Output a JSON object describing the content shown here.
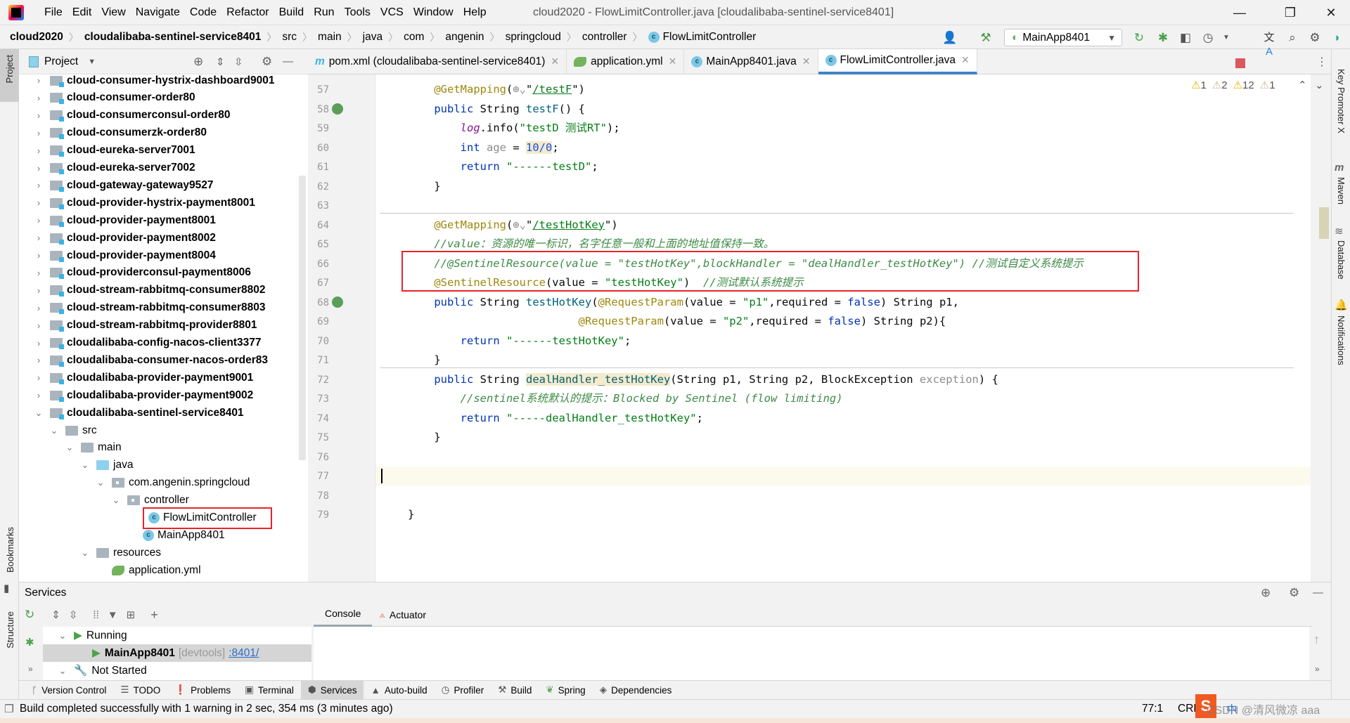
{
  "window": {
    "title": "cloud2020 - FlowLimitController.java [cloudalibaba-sentinel-service8401]"
  },
  "menu": [
    "File",
    "Edit",
    "View",
    "Navigate",
    "Code",
    "Refactor",
    "Build",
    "Run",
    "Tools",
    "VCS",
    "Window",
    "Help"
  ],
  "breadcrumb": [
    "cloud2020",
    "cloudalibaba-sentinel-service8401",
    "src",
    "main",
    "java",
    "com",
    "angenin",
    "springcloud",
    "controller",
    "FlowLimitController"
  ],
  "toolbar": {
    "run_config": "MainApp8401",
    "icons": [
      "user-icon",
      "hammer-icon",
      "rerun-icon",
      "debug-icon",
      "coverage-icon",
      "profile-icon",
      "stop-icon",
      "translate-icon",
      "search-icon",
      "settings-icon",
      "toolbox-icon"
    ]
  },
  "project": {
    "title": "Project",
    "items": [
      {
        "label": "cloud-consumer-hystrix-dashboard9001",
        "depth": 1,
        "type": "module",
        "exp": false
      },
      {
        "label": "cloud-consumer-order80",
        "depth": 1,
        "type": "module",
        "exp": false
      },
      {
        "label": "cloud-consumerconsul-order80",
        "depth": 1,
        "type": "module",
        "exp": false
      },
      {
        "label": "cloud-consumerzk-order80",
        "depth": 1,
        "type": "module",
        "exp": false
      },
      {
        "label": "cloud-eureka-server7001",
        "depth": 1,
        "type": "module",
        "exp": false
      },
      {
        "label": "cloud-eureka-server7002",
        "depth": 1,
        "type": "module",
        "exp": false
      },
      {
        "label": "cloud-gateway-gateway9527",
        "depth": 1,
        "type": "module",
        "exp": false
      },
      {
        "label": "cloud-provider-hystrix-payment8001",
        "depth": 1,
        "type": "module",
        "exp": false
      },
      {
        "label": "cloud-provider-payment8001",
        "depth": 1,
        "type": "module",
        "exp": false
      },
      {
        "label": "cloud-provider-payment8002",
        "depth": 1,
        "type": "module",
        "exp": false
      },
      {
        "label": "cloud-provider-payment8004",
        "depth": 1,
        "type": "module",
        "exp": false
      },
      {
        "label": "cloud-providerconsul-payment8006",
        "depth": 1,
        "type": "module",
        "exp": false
      },
      {
        "label": "cloud-stream-rabbitmq-consumer8802",
        "depth": 1,
        "type": "module",
        "exp": false
      },
      {
        "label": "cloud-stream-rabbitmq-consumer8803",
        "depth": 1,
        "type": "module",
        "exp": false
      },
      {
        "label": "cloud-stream-rabbitmq-provider8801",
        "depth": 1,
        "type": "module",
        "exp": false
      },
      {
        "label": "cloudalibaba-config-nacos-client3377",
        "depth": 1,
        "type": "module",
        "exp": false
      },
      {
        "label": "cloudalibaba-consumer-nacos-order83",
        "depth": 1,
        "type": "module",
        "exp": false
      },
      {
        "label": "cloudalibaba-provider-payment9001",
        "depth": 1,
        "type": "module",
        "exp": false
      },
      {
        "label": "cloudalibaba-provider-payment9002",
        "depth": 1,
        "type": "module",
        "exp": false
      },
      {
        "label": "cloudalibaba-sentinel-service8401",
        "depth": 1,
        "type": "module",
        "exp": true
      },
      {
        "label": "src",
        "depth": 2,
        "type": "folder",
        "exp": true
      },
      {
        "label": "main",
        "depth": 3,
        "type": "folder",
        "exp": true
      },
      {
        "label": "java",
        "depth": 4,
        "type": "src",
        "exp": true
      },
      {
        "label": "com.angenin.springcloud",
        "depth": 5,
        "type": "pkg",
        "exp": true
      },
      {
        "label": "controller",
        "depth": 6,
        "type": "pkg",
        "exp": true
      },
      {
        "label": "FlowLimitController",
        "depth": 7,
        "type": "class",
        "selected": true
      },
      {
        "label": "MainApp8401",
        "depth": 7,
        "type": "class"
      },
      {
        "label": "resources",
        "depth": 4,
        "type": "folder",
        "exp": true
      },
      {
        "label": "application.yml",
        "depth": 5,
        "type": "yml"
      }
    ]
  },
  "editor": {
    "tabs": [
      {
        "label": "pom.xml (cloudalibaba-sentinel-service8401)",
        "icon": "maven-icon"
      },
      {
        "label": "application.yml",
        "icon": "yml-icon"
      },
      {
        "label": "MainApp8401.java",
        "icon": "class-icon"
      },
      {
        "label": "FlowLimitController.java",
        "icon": "class-icon",
        "active": true
      }
    ],
    "inspections": [
      {
        "count": "1",
        "kind": "warning"
      },
      {
        "count": "2",
        "kind": "weak-warning"
      },
      {
        "count": "12",
        "kind": "warning"
      },
      {
        "count": "1",
        "kind": "typo"
      }
    ],
    "caret_line": 77,
    "lines": [
      {
        "n": 57,
        "tokens": [
          [
            "    ",
            ""
          ],
          [
            "@GetMapping",
            "an"
          ],
          [
            "(",
            ""
          ],
          [
            "⊕⌄",
            "gr"
          ],
          [
            "\"",
            ""
          ],
          [
            "/testF",
            "st ul"
          ],
          [
            "\")",
            ""
          ]
        ]
      },
      {
        "n": 58,
        "run": true,
        "tokens": [
          [
            "    ",
            ""
          ],
          [
            "public",
            "kw"
          ],
          [
            " String ",
            ""
          ],
          [
            "testF",
            "fn"
          ],
          [
            "() {",
            ""
          ]
        ]
      },
      {
        "n": 59,
        "tokens": [
          [
            "        ",
            ""
          ],
          [
            "log",
            "fld"
          ],
          [
            ".info(",
            ""
          ],
          [
            "\"testD 测试RT\"",
            "st"
          ],
          [
            ");",
            ""
          ]
        ]
      },
      {
        "n": 60,
        "tokens": [
          [
            "        ",
            ""
          ],
          [
            "int",
            "kw"
          ],
          [
            " ",
            ""
          ],
          [
            "age",
            "gr"
          ],
          [
            " = ",
            ""
          ],
          [
            "10/0",
            "nm hl"
          ],
          [
            ";",
            ""
          ]
        ]
      },
      {
        "n": 61,
        "tokens": [
          [
            "        ",
            ""
          ],
          [
            "return",
            "kw"
          ],
          [
            " ",
            ""
          ],
          [
            "\"------testD\"",
            "st"
          ],
          [
            ";",
            ""
          ]
        ]
      },
      {
        "n": 62,
        "tokens": [
          [
            "    }",
            ""
          ]
        ]
      },
      {
        "n": 63,
        "tokens": []
      },
      {
        "n": 64,
        "tokens": [
          [
            "    ",
            ""
          ],
          [
            "@GetMapping",
            "an"
          ],
          [
            "(",
            ""
          ],
          [
            "⊕⌄",
            "gr"
          ],
          [
            "\"",
            ""
          ],
          [
            "/testHotKey",
            "st ul"
          ],
          [
            "\")",
            ""
          ]
        ]
      },
      {
        "n": 65,
        "tokens": [
          [
            "    ",
            ""
          ],
          [
            "//value：资源的唯一标识，名字任意一般和上面的地址值保持一致。",
            "cm"
          ]
        ]
      },
      {
        "n": 66,
        "tokens": [
          [
            "    ",
            ""
          ],
          [
            "//@SentinelResource(value = \"testHotKey\",blockHandler = \"dealHandler_testHotKey\") //测试自定义系统提示",
            "cm"
          ]
        ]
      },
      {
        "n": 67,
        "tokens": [
          [
            "    ",
            ""
          ],
          [
            "@SentinelResource",
            "an"
          ],
          [
            "(value = ",
            ""
          ],
          [
            "\"testHotKey\"",
            "st"
          ],
          [
            ")  ",
            ""
          ],
          [
            "//测试默认系统提示",
            "cm"
          ]
        ]
      },
      {
        "n": 68,
        "run": true,
        "tokens": [
          [
            "    ",
            ""
          ],
          [
            "public",
            "kw"
          ],
          [
            " String ",
            ""
          ],
          [
            "testHotKey",
            "fn"
          ],
          [
            "(",
            ""
          ],
          [
            "@RequestParam",
            "an"
          ],
          [
            "(value = ",
            ""
          ],
          [
            "\"p1\"",
            "st"
          ],
          [
            ",required = ",
            ""
          ],
          [
            "false",
            "kw"
          ],
          [
            ") String p1,",
            ""
          ]
        ]
      },
      {
        "n": 69,
        "tokens": [
          [
            "                          ",
            ""
          ],
          [
            "@RequestParam",
            "an"
          ],
          [
            "(value = ",
            ""
          ],
          [
            "\"p2\"",
            "st"
          ],
          [
            ",required = ",
            ""
          ],
          [
            "false",
            "kw"
          ],
          [
            ") String p2){",
            ""
          ]
        ]
      },
      {
        "n": 70,
        "tokens": [
          [
            "        ",
            ""
          ],
          [
            "return",
            "kw"
          ],
          [
            " ",
            ""
          ],
          [
            "\"------testHotKey\"",
            "st"
          ],
          [
            ";",
            ""
          ]
        ]
      },
      {
        "n": 71,
        "tokens": [
          [
            "    }",
            ""
          ]
        ]
      },
      {
        "n": 72,
        "tokens": [
          [
            "    ",
            ""
          ],
          [
            "public",
            "kw"
          ],
          [
            " String ",
            ""
          ],
          [
            "dealHandler_testHotKey",
            "fn hl"
          ],
          [
            "(String p1, String p2, BlockException ",
            ""
          ],
          [
            "exception",
            "gr"
          ],
          [
            ") {",
            ""
          ]
        ]
      },
      {
        "n": 73,
        "tokens": [
          [
            "        ",
            ""
          ],
          [
            "//sentinel系统默认的提示：Blocked by Sentinel (flow limiting)",
            "cm"
          ]
        ]
      },
      {
        "n": 74,
        "tokens": [
          [
            "        ",
            ""
          ],
          [
            "return",
            "kw"
          ],
          [
            " ",
            ""
          ],
          [
            "\"-----dealHandler_testHotKey\"",
            "st"
          ],
          [
            ";",
            ""
          ]
        ]
      },
      {
        "n": 75,
        "tokens": [
          [
            "    }",
            ""
          ]
        ]
      },
      {
        "n": 76,
        "tokens": []
      },
      {
        "n": 77,
        "tokens": []
      },
      {
        "n": 78,
        "tokens": []
      },
      {
        "n": 79,
        "tokens": [
          [
            "}",
            ""
          ]
        ]
      }
    ]
  },
  "left_stripe": {
    "project": "Project",
    "bookmarks": "Bookmarks",
    "structure": "Structure"
  },
  "right_stripe": [
    "Key Promoter X",
    "Maven",
    "Database",
    "Notifications"
  ],
  "services": {
    "title": "Services",
    "tabs": [
      "Console",
      "Actuator"
    ],
    "tree": [
      {
        "label": "Running",
        "type": "group"
      },
      {
        "label": "MainApp8401",
        "extra": "[devtools]",
        "link": ":8401/",
        "type": "app"
      },
      {
        "label": "Not Started",
        "type": "group"
      }
    ]
  },
  "bottom_tabs": [
    "Version Control",
    "TODO",
    "Problems",
    "Terminal",
    "Services",
    "Auto-build",
    "Profiler",
    "Build",
    "Spring",
    "Dependencies"
  ],
  "bottom_active": "Services",
  "status": {
    "message": "Build completed successfully with 1 warning in 2 sec, 354 ms (3 minutes ago)",
    "position": "77:1",
    "line_sep": "CRLF",
    "watermark": "CSDN @清风微凉 aaa",
    "ime": "中"
  },
  "colors": {
    "accent": "#4083c9",
    "highlight_box": "#e8232a",
    "caret_line": "#fcfaed"
  }
}
